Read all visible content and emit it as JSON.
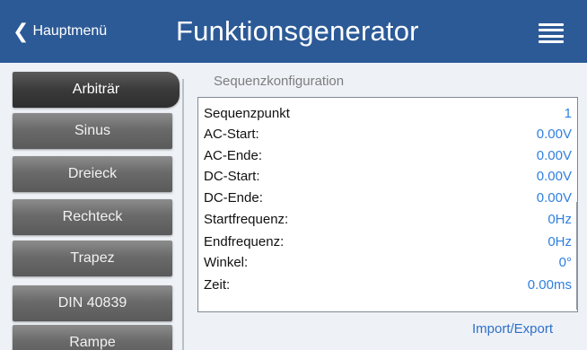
{
  "header": {
    "back_label": "Hauptmenü",
    "title": "Funktionsgenerator"
  },
  "sidebar": {
    "items": [
      {
        "label": "Arbiträr",
        "active": true
      },
      {
        "label": "Sinus",
        "active": false
      },
      {
        "label": "Dreieck",
        "active": false
      },
      {
        "label": "Rechteck",
        "active": false
      },
      {
        "label": "Trapez",
        "active": false
      },
      {
        "label": "DIN 40839",
        "active": false
      },
      {
        "label": "Rampe",
        "active": false
      }
    ]
  },
  "main": {
    "section_title": "Sequenzkonfiguration",
    "rows": [
      {
        "label": "Sequenzpunkt",
        "value": "1"
      },
      {
        "label": "AC-Start:",
        "value": "0.00V"
      },
      {
        "label": "AC-Ende:",
        "value": "0.00V"
      },
      {
        "label": "DC-Start:",
        "value": "0.00V"
      },
      {
        "label": "DC-Ende:",
        "value": "0.00V"
      },
      {
        "label": "Startfrequenz:",
        "value": "0Hz"
      },
      {
        "label": "Endfrequenz:",
        "value": "0Hz"
      },
      {
        "label": "Winkel:",
        "value": "0°"
      },
      {
        "label": "Zeit:",
        "value": "0.00ms"
      }
    ],
    "import_export_label": "Import/Export"
  },
  "colors": {
    "header_bg": "#2c5a97",
    "value_blue": "#2f7fe0",
    "button_gray": "#6a6a6a",
    "active_button": "#3a3a3a"
  },
  "icons": {
    "back": "chevron-left-icon",
    "menu": "hamburger-menu-icon"
  }
}
